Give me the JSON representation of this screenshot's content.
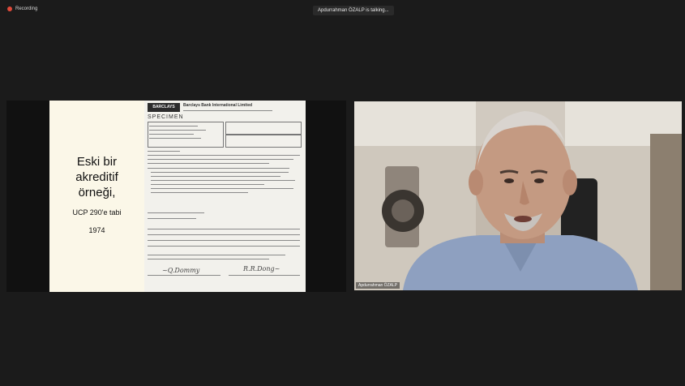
{
  "recording": {
    "label": "Recording"
  },
  "talking": {
    "text": "Apdurrahman ÖZALP is talking..."
  },
  "slide": {
    "title_lines": [
      "Eski bir",
      "akreditif",
      "örneği,"
    ],
    "ucp_text": "UCP 290'e tabi",
    "year": "1974"
  },
  "document": {
    "bank_logo": "BARCLAYS",
    "bank_name": "Barclays Bank International Limited",
    "specimen": "SPECIMEN"
  },
  "participant": {
    "name": "Apdurrahman ÖZALP"
  },
  "colors": {
    "recording_dot": "#e04a3a",
    "background": "#1b1b1b"
  }
}
